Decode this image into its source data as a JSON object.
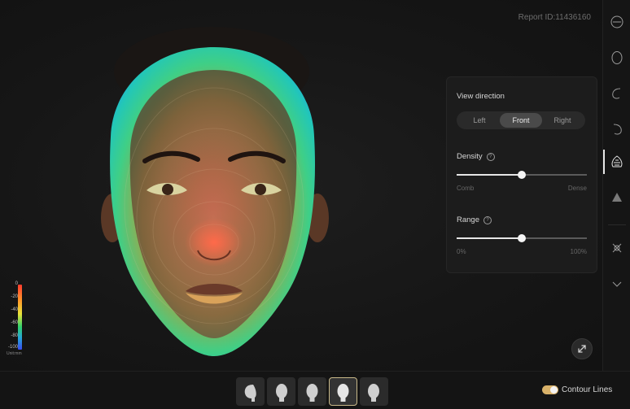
{
  "header": {
    "report_id": "Report ID:11436160"
  },
  "legend": {
    "ticks": [
      "0",
      "-20",
      "-40",
      "-60",
      "-80",
      "-100"
    ],
    "unit": "Unit:mm"
  },
  "panel": {
    "view_direction_title": "View direction",
    "view_options": [
      "Left",
      "Front",
      "Right"
    ],
    "view_selected": "Front",
    "density": {
      "label": "Density",
      "min_label": "Comb",
      "max_label": "Dense",
      "value": 0.5
    },
    "range": {
      "label": "Range",
      "min_label": "0%",
      "max_label": "100%",
      "value": 0.5
    }
  },
  "sidebar": {
    "icons": [
      "face-front-icon",
      "face-outline-icon",
      "face-side-left-icon",
      "face-side-right-icon",
      "contour-mesh-icon",
      "shaded-mesh-icon",
      "landmarks-icon",
      "chevron-down-icon"
    ],
    "active": "contour-mesh-icon"
  },
  "bottom": {
    "thumbnails": [
      "head-left-profile",
      "head-left-quarter",
      "head-front",
      "head-front-selected",
      "head-right-quarter"
    ],
    "selected_index": 3,
    "contour_lines_label": "Contour Lines",
    "contour_lines_on": true
  },
  "colors": {
    "accent": "#d9b26a",
    "background": "#141414",
    "panel": "#1c1c1c"
  }
}
